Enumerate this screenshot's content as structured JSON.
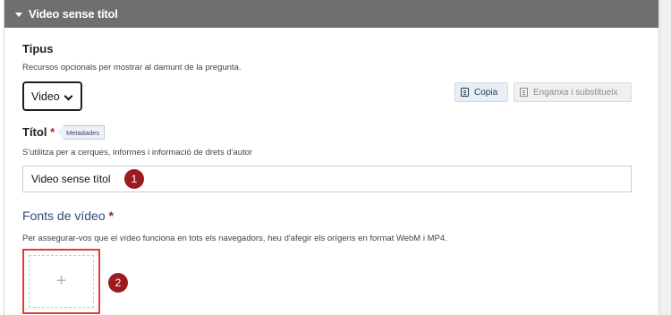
{
  "header": {
    "title": "Video sense títol"
  },
  "tipus": {
    "label": "Tipus",
    "description": "Recursos opcionals per mostrar al damunt de la pregunta.",
    "selected": "Video",
    "copy_button": "Copia",
    "paste_button": "Enganxa i substitueix"
  },
  "titol": {
    "label": "Títol",
    "required_mark": "*",
    "tag": "Metadades",
    "description": "S'utilitza per a cerques, informes i informació de drets d'autor",
    "value": "Video sense títol"
  },
  "fonts": {
    "label": "Fonts de vídeo",
    "required_mark": "*",
    "description": "Per assegurar-vos que el vídeo funciona en tots els navegadors, heu d'afegir els orígens en format WebM i MP4.",
    "add_symbol": "+"
  },
  "markers": {
    "first": "1",
    "second": "2"
  },
  "colors": {
    "header_bg": "#6f6f6f",
    "required": "#b2222c",
    "marker": "#9b1b1f",
    "highlight": "#e53a3a",
    "section_title": "#2f4a74"
  }
}
